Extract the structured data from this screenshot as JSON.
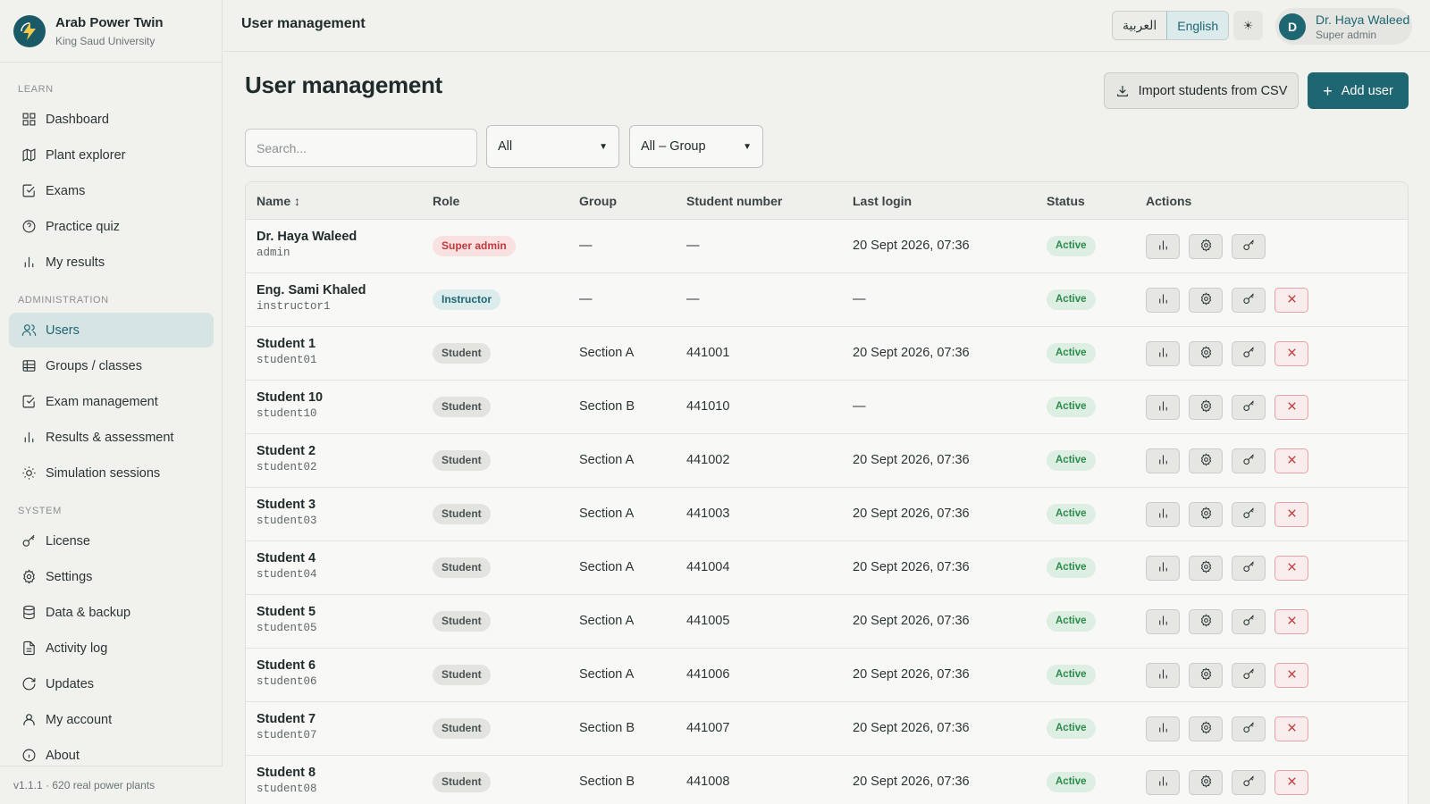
{
  "brand": {
    "title": "Arab Power Twin",
    "subtitle": "King Saud University"
  },
  "topbar": {
    "title": "User management",
    "lang_ar": "العربية",
    "lang_en": "English",
    "theme_icon": "sun-icon",
    "user_initial": "D",
    "user_name": "Dr. Haya Waleed",
    "user_role": "Super admin"
  },
  "sidebar": {
    "sections": {
      "learn": "LEARN",
      "admin": "ADMINISTRATION",
      "system": "SYSTEM"
    },
    "items": [
      {
        "label": "Dashboard",
        "icon": "grid-icon"
      },
      {
        "label": "Plant explorer",
        "icon": "map-icon"
      },
      {
        "label": "Exams",
        "icon": "check-square-icon"
      },
      {
        "label": "Practice quiz",
        "icon": "help-circle-icon"
      },
      {
        "label": "My results",
        "icon": "bar-chart-icon"
      },
      {
        "label": "Users",
        "icon": "users-icon"
      },
      {
        "label": "Groups / classes",
        "icon": "table-icon"
      },
      {
        "label": "Exam management",
        "icon": "check-square-icon"
      },
      {
        "label": "Results & assessment",
        "icon": "bar-chart-icon"
      },
      {
        "label": "Simulation sessions",
        "icon": "sun-icon"
      },
      {
        "label": "License",
        "icon": "key-icon"
      },
      {
        "label": "Settings",
        "icon": "gear-icon"
      },
      {
        "label": "Data & backup",
        "icon": "database-icon"
      },
      {
        "label": "Activity log",
        "icon": "file-text-icon"
      },
      {
        "label": "Updates",
        "icon": "refresh-icon"
      },
      {
        "label": "My account",
        "icon": "user-icon"
      },
      {
        "label": "About",
        "icon": "info-icon"
      }
    ],
    "footer": "v1.1.1 · 620 real power plants"
  },
  "main": {
    "title": "User management",
    "import_label": "Import students from CSV",
    "add_label": "Add user",
    "search_placeholder": "Search...",
    "filter_role": "All",
    "filter_group": "All – Group"
  },
  "table": {
    "headers": {
      "name": "Name ↕",
      "role": "Role",
      "group": "Group",
      "student_number": "Student number",
      "last_login": "Last login",
      "status": "Status",
      "actions": "Actions"
    },
    "rows": [
      {
        "name": "Dr. Haya Waleed",
        "username": "admin",
        "role": "Super admin",
        "group": "—",
        "number": "—",
        "last_login": "20 Sept 2026, 07:36",
        "status": "Active"
      },
      {
        "name": "Eng. Sami Khaled",
        "username": "instructor1",
        "role": "Instructor",
        "group": "—",
        "number": "—",
        "last_login": "—",
        "status": "Active"
      },
      {
        "name": "Student 1",
        "username": "student01",
        "role": "Student",
        "group": "Section A",
        "number": "441001",
        "last_login": "20 Sept 2026, 07:36",
        "status": "Active"
      },
      {
        "name": "Student 10",
        "username": "student10",
        "role": "Student",
        "group": "Section B",
        "number": "441010",
        "last_login": "—",
        "status": "Active"
      },
      {
        "name": "Student 2",
        "username": "student02",
        "role": "Student",
        "group": "Section A",
        "number": "441002",
        "last_login": "20 Sept 2026, 07:36",
        "status": "Active"
      },
      {
        "name": "Student 3",
        "username": "student03",
        "role": "Student",
        "group": "Section A",
        "number": "441003",
        "last_login": "20 Sept 2026, 07:36",
        "status": "Active"
      },
      {
        "name": "Student 4",
        "username": "student04",
        "role": "Student",
        "group": "Section A",
        "number": "441004",
        "last_login": "20 Sept 2026, 07:36",
        "status": "Active"
      },
      {
        "name": "Student 5",
        "username": "student05",
        "role": "Student",
        "group": "Section A",
        "number": "441005",
        "last_login": "20 Sept 2026, 07:36",
        "status": "Active"
      },
      {
        "name": "Student 6",
        "username": "student06",
        "role": "Student",
        "group": "Section A",
        "number": "441006",
        "last_login": "20 Sept 2026, 07:36",
        "status": "Active"
      },
      {
        "name": "Student 7",
        "username": "student07",
        "role": "Student",
        "group": "Section B",
        "number": "441007",
        "last_login": "20 Sept 2026, 07:36",
        "status": "Active"
      },
      {
        "name": "Student 8",
        "username": "student08",
        "role": "Student",
        "group": "Section B",
        "number": "441008",
        "last_login": "20 Sept 2026, 07:36",
        "status": "Active"
      }
    ]
  },
  "colors": {
    "accent": "#1e6672",
    "danger": "#c0393b",
    "success": "#2b8a4c"
  }
}
